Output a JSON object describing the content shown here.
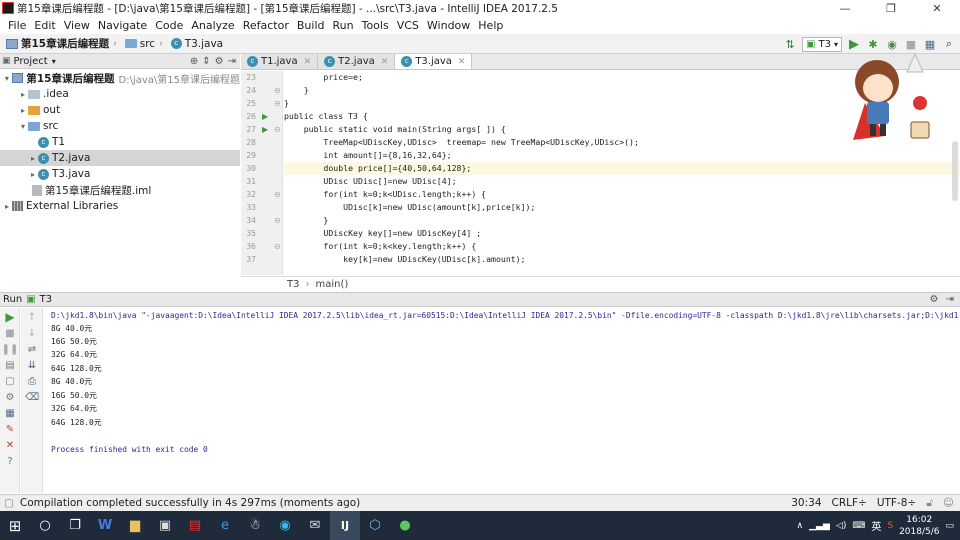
{
  "window": {
    "title": "第15章课后编程题 - [D:\\java\\第15章课后编程题] - [第15章课后编程题] - ...\\src\\T3.java - IntelliJ IDEA 2017.2.5",
    "minimize": "—",
    "maximize": "❐",
    "close": "✕"
  },
  "menu": [
    "File",
    "Edit",
    "View",
    "Navigate",
    "Code",
    "Analyze",
    "Refactor",
    "Build",
    "Run",
    "Tools",
    "VCS",
    "Window",
    "Help"
  ],
  "navbar": {
    "crumbs": [
      "第15章课后编程题",
      "src",
      "T3.java"
    ],
    "run_config": "T3"
  },
  "project_panel": {
    "title": "Project",
    "tree": [
      {
        "label": "第15章课后编程题",
        "extra": "D:\\java\\第15章课后编程题",
        "level": 0,
        "arrow": "▾",
        "icon": "module"
      },
      {
        "label": ".idea",
        "extra": "",
        "level": 1,
        "arrow": "▸",
        "icon": "folder"
      },
      {
        "label": "out",
        "extra": "",
        "level": 1,
        "arrow": "▸",
        "icon": "out-folder"
      },
      {
        "label": "src",
        "extra": "",
        "level": 1,
        "arrow": "▾",
        "icon": "source-folder"
      },
      {
        "label": "T1",
        "extra": "",
        "level": 2,
        "arrow": "",
        "icon": "class"
      },
      {
        "label": "T2.java",
        "extra": "",
        "level": 2,
        "arrow": "▸",
        "icon": "class",
        "selected": true
      },
      {
        "label": "T3.java",
        "extra": "",
        "level": 2,
        "arrow": "▸",
        "icon": "class"
      },
      {
        "label": "第15章课后编程题.iml",
        "extra": "",
        "level": 1,
        "arrow": "",
        "icon": "iml"
      },
      {
        "label": "External Libraries",
        "extra": "",
        "level": 0,
        "arrow": "▸",
        "icon": "library"
      }
    ]
  },
  "editor": {
    "tabs": [
      {
        "label": "T1.java",
        "active": false
      },
      {
        "label": "T2.java",
        "active": false
      },
      {
        "label": "T3.java",
        "active": true
      }
    ],
    "lines": [
      {
        "n": "23",
        "text": "        price=e;"
      },
      {
        "n": "24",
        "text": "    }"
      },
      {
        "n": "25",
        "text": "}"
      },
      {
        "n": "26",
        "text": "public class T3 {"
      },
      {
        "n": "27",
        "text": "    public static void main(String args[ ]) {"
      },
      {
        "n": "28",
        "text": "        TreeMap<UDiscKey,UDisc>  treemap= new TreeMap<UDiscKey,UDisc>();"
      },
      {
        "n": "29",
        "text": "        int amount[]={8,16,32,64};"
      },
      {
        "n": "30",
        "text": "        double price[]={40,50,64,128};"
      },
      {
        "n": "31",
        "text": "        UDisc UDisc[]=new UDisc[4];"
      },
      {
        "n": "32",
        "text": "        for(int k=0;k<UDisc.length;k++) {"
      },
      {
        "n": "33",
        "text": "            UDisc[k]=new UDisc(amount[k],price[k]);"
      },
      {
        "n": "34",
        "text": "        }"
      },
      {
        "n": "35",
        "text": "        UDiscKey key[]=new UDiscKey[4] ;"
      },
      {
        "n": "36",
        "text": "        for(int k=0;k<key.length;k++) {"
      },
      {
        "n": "37",
        "text": "            key[k]=new UDiscKey(UDisc[k].amount);"
      }
    ],
    "breadcrumb": [
      "T3",
      "main()"
    ]
  },
  "run_panel": {
    "label": "Run",
    "config": "T3",
    "command": "D:\\jkd1.8\\bin\\java \"-javaagent:D:\\Idea\\IntelliJ IDEA 2017.2.5\\lib\\idea_rt.jar=60515:D:\\Idea\\IntelliJ IDEA 2017.2.5\\bin\" -Dfile.encoding=UTF-8 -classpath D:\\jkd1.8\\jre\\lib\\charsets.jar;D:\\jkd1.8\\jre\\lib\\",
    "output": [
      "8G 40.0元",
      "16G 50.0元",
      "32G 64.0元",
      "64G 128.0元",
      "8G 40.0元",
      "16G 50.0元",
      "32G 64.0元",
      "64G 128.0元"
    ],
    "exit": "Process finished with exit code 0"
  },
  "statusbar": {
    "message": "Compilation completed successfully in 4s 297ms (moments ago)",
    "position": "30:34",
    "line_sep": "CRLF÷",
    "encoding": "UTF-8÷"
  },
  "taskbar": {
    "time": "16:02",
    "date": "2018/5/6",
    "ime": "英"
  },
  "colors": {
    "accent_run": "#3c9a3c",
    "taskbar": "#1f2b3a"
  }
}
